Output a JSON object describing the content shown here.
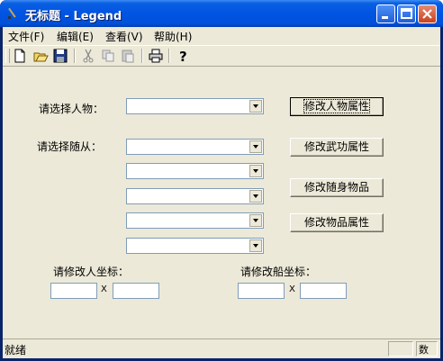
{
  "window": {
    "title": "无标题 - Legend"
  },
  "menu": {
    "items": [
      {
        "label": "文件(F)"
      },
      {
        "label": "编辑(E)"
      },
      {
        "label": "查看(V)"
      },
      {
        "label": "帮助(H)"
      }
    ]
  },
  "toolbar": {
    "icons": [
      "new-file-icon",
      "open-folder-icon",
      "save-icon",
      "cut-icon",
      "copy-icon",
      "paste-icon",
      "print-icon",
      "help-icon"
    ]
  },
  "form": {
    "character_label": "请选择人物：",
    "followers_label": "请选择随从：",
    "edit_character_button": "修改人物属性",
    "edit_martial_button": "修改武功属性",
    "edit_follower_items_button": "修改随身物品",
    "edit_items_button": "修改物品属性",
    "person_coord_label": "请修改人坐标：",
    "ship_coord_label": "请修改船坐标：",
    "coord_separator": "X"
  },
  "status": {
    "text": "就绪",
    "pane2": "数"
  },
  "colors": {
    "title_blue": "#0054e3",
    "face": "#ece9d8",
    "close_red": "#c9401f"
  }
}
